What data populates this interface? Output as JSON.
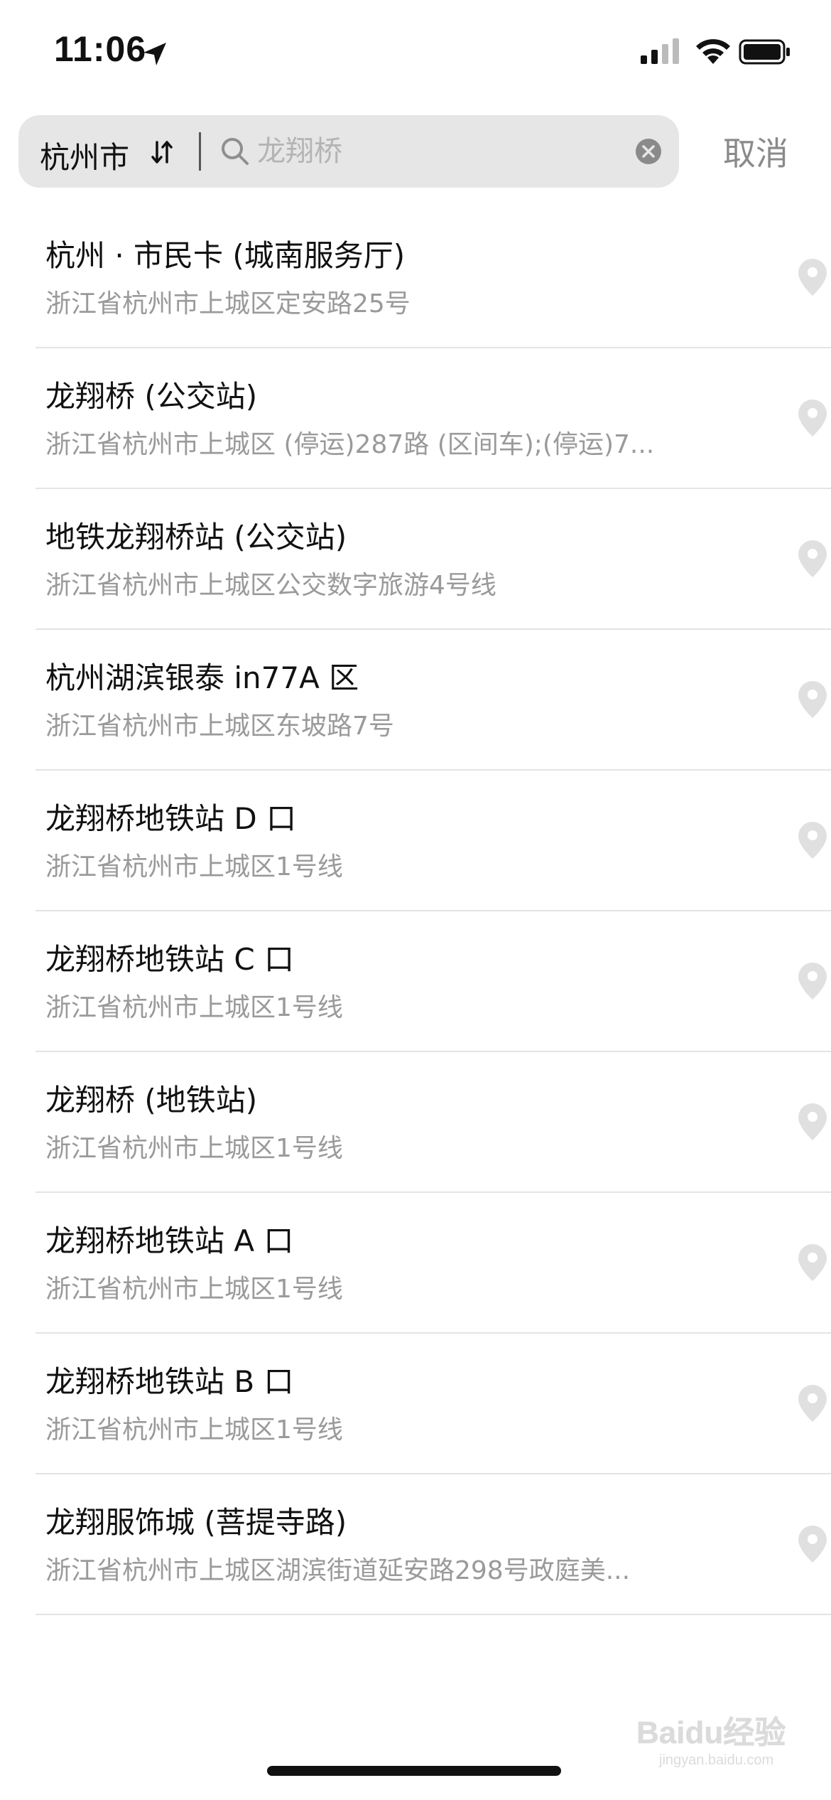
{
  "status_bar": {
    "time": "11:06"
  },
  "search": {
    "city": "杭州市",
    "placeholder": "龙翔桥",
    "cancel_label": "取消"
  },
  "results": [
    {
      "title": "杭州 · 市民卡 (城南服务厅)",
      "address": "浙江省杭州市上城区定安路25号"
    },
    {
      "title": "龙翔桥 (公交站)",
      "address": "浙江省杭州市上城区 (停运)287路 (区间车);(停运)7..."
    },
    {
      "title": "地铁龙翔桥站 (公交站)",
      "address": "浙江省杭州市上城区公交数字旅游4号线"
    },
    {
      "title": "杭州湖滨银泰 in77A 区",
      "address": "浙江省杭州市上城区东坡路7号"
    },
    {
      "title": "龙翔桥地铁站 D 口",
      "address": "浙江省杭州市上城区1号线"
    },
    {
      "title": "龙翔桥地铁站 C 口",
      "address": "浙江省杭州市上城区1号线"
    },
    {
      "title": "龙翔桥 (地铁站)",
      "address": "浙江省杭州市上城区1号线"
    },
    {
      "title": "龙翔桥地铁站 A 口",
      "address": "浙江省杭州市上城区1号线"
    },
    {
      "title": "龙翔桥地铁站 B 口",
      "address": "浙江省杭州市上城区1号线"
    },
    {
      "title": "龙翔服饰城 (菩提寺路)",
      "address": "浙江省杭州市上城区湖滨街道延安路298号政庭美..."
    }
  ],
  "watermark": {
    "text": "Baidu经验",
    "subtext": "jingyan.baidu.com"
  },
  "colors": {
    "search_bg": "#e6e6e6",
    "secondary_text": "#9a9a9a",
    "pin": "#e0e0e0"
  }
}
